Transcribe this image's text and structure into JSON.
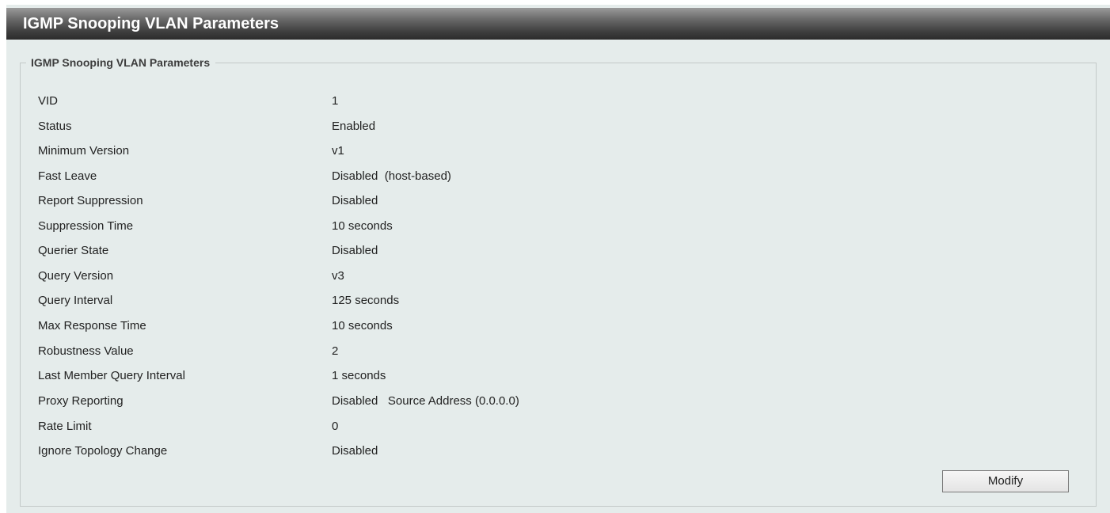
{
  "header": {
    "title": "IGMP Snooping VLAN Parameters"
  },
  "panel": {
    "legend": "IGMP Snooping VLAN Parameters",
    "rows": [
      {
        "label": "VID",
        "value": "1"
      },
      {
        "label": "Status",
        "value": "Enabled"
      },
      {
        "label": "Minimum Version",
        "value": "v1"
      },
      {
        "label": "Fast Leave",
        "value": "Disabled",
        "extra": "(host-based)"
      },
      {
        "label": "Report Suppression",
        "value": "Disabled"
      },
      {
        "label": "Suppression Time",
        "value": "10 seconds"
      },
      {
        "label": "Querier State",
        "value": "Disabled"
      },
      {
        "label": "Query Version",
        "value": "v3"
      },
      {
        "label": "Query Interval",
        "value": "125 seconds"
      },
      {
        "label": "Max Response Time",
        "value": "10 seconds"
      },
      {
        "label": "Robustness Value",
        "value": "2"
      },
      {
        "label": "Last Member Query Interval",
        "value": "1 seconds"
      },
      {
        "label": "Proxy Reporting",
        "value": "Disabled",
        "extra": "Source Address (0.0.0.0)"
      },
      {
        "label": "Rate Limit",
        "value": "0"
      },
      {
        "label": "Ignore Topology Change",
        "value": "Disabled"
      }
    ],
    "modify_label": "Modify"
  },
  "colors": {
    "background": "#e5eceb",
    "title_bar": "#3e3e3e",
    "title_text": "#ffffff"
  }
}
